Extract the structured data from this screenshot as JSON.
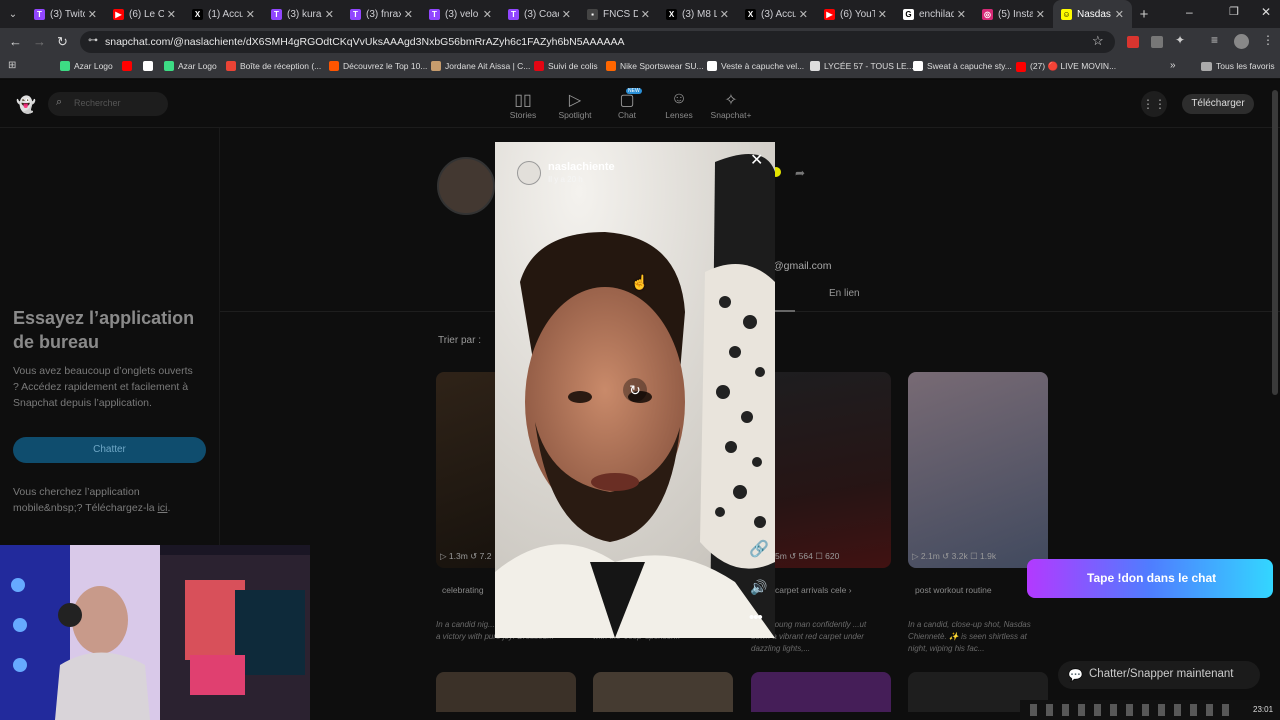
{
  "browser": {
    "tabs": [
      {
        "label": "(3) Twitc",
        "icon": "twitch-icon",
        "color": "#9146ff",
        "glyph": "T"
      },
      {
        "label": "(6) Le Ch",
        "icon": "youtube-icon",
        "color": "#ff0000",
        "glyph": "▶"
      },
      {
        "label": "(1) Accu",
        "icon": "x-icon",
        "color": "#000000",
        "glyph": "X"
      },
      {
        "label": "(3) kuran",
        "icon": "twitch-icon",
        "color": "#9146ff",
        "glyph": "T"
      },
      {
        "label": "(3) fnrax",
        "icon": "twitch-icon",
        "color": "#9146ff",
        "glyph": "T"
      },
      {
        "label": "(3) velo",
        "icon": "twitch-icon",
        "color": "#9146ff",
        "glyph": "T"
      },
      {
        "label": "(3) Coac",
        "icon": "twitch-icon",
        "color": "#9146ff",
        "glyph": "T"
      },
      {
        "label": "FNCS Dr",
        "icon": "page-icon",
        "color": "#444444",
        "glyph": "▪"
      },
      {
        "label": "(3) M8 L",
        "icon": "x-icon",
        "color": "#000000",
        "glyph": "X"
      },
      {
        "label": "(3) Accu",
        "icon": "x-icon",
        "color": "#000000",
        "glyph": "X"
      },
      {
        "label": "(6) YouTu",
        "icon": "youtube-icon",
        "color": "#ff0000",
        "glyph": "▶"
      },
      {
        "label": "enchilad",
        "icon": "google-icon",
        "color": "#ffffff",
        "glyph": "G"
      },
      {
        "label": "(5) Insta",
        "icon": "instagram-icon",
        "color": "#d62976",
        "glyph": "◎"
      },
      {
        "label": "Nasdas",
        "icon": "snapchat-icon",
        "color": "#fffc00",
        "glyph": "☺",
        "active": true
      }
    ],
    "url": "snapchat.com/@naslachiente/dX6SMH4gRGOdtCKqVvUksAAAgd3NxbG56bmRrAZyh6c1FAZyh6bN5AAAAAA",
    "bookmarks": [
      {
        "label": "Azar Logo",
        "color": "#3ddc84"
      },
      {
        "label": "",
        "color": "#ff0000"
      },
      {
        "label": "",
        "color": "#ffffff"
      },
      {
        "label": "Azar Logo",
        "color": "#3ddc84"
      },
      {
        "label": "Boîte de réception (...",
        "color": "#ea4335"
      },
      {
        "label": "Découvrez le Top 10...",
        "color": "#ff5500"
      },
      {
        "label": "Jordane Ait Aissa | C...",
        "color": "#c69c6d"
      },
      {
        "label": "Suivi de colis",
        "color": "#e30613"
      },
      {
        "label": "Nike Sportswear SU...",
        "color": "#ff6600"
      },
      {
        "label": "Veste à capuche vel...",
        "color": "#ffffff"
      },
      {
        "label": "LYCÉE 57 - TOUS LE...",
        "color": "#dddddd"
      },
      {
        "label": "Sweat à capuche sty...",
        "color": "#ffffff"
      },
      {
        "label": "(27) 🔴 LIVE MOVIN...",
        "color": "#ff0000"
      }
    ],
    "all_favs": "Tous les favoris"
  },
  "snap": {
    "search_placeholder": "Rechercher",
    "nav": [
      {
        "label": "Stories",
        "icon": "stories-icon",
        "glyph": "▯▯"
      },
      {
        "label": "Spotlight",
        "icon": "spotlight-icon",
        "glyph": "▷"
      },
      {
        "label": "Chat",
        "icon": "chat-icon",
        "glyph": "▢"
      },
      {
        "label": "Lenses",
        "icon": "lenses-icon",
        "glyph": "☺"
      },
      {
        "label": "Snapchat+",
        "icon": "snapchat-plus-icon",
        "glyph": "✧"
      }
    ],
    "chat_badge": "NEW",
    "download_label": "Télécharger",
    "sidebar": {
      "title": "Essayez l’application de bureau",
      "body": "Vous avez beaucoup d’onglets ouverts ? Accédez rapidement et facilement à Snapchat depuis l’application.",
      "chat_button": "Chatter",
      "mobile_text": "Vous cherchez l’application mobile&nbsp;? Téléchargez-la ",
      "mobile_link": "ici",
      "mobile_end": "."
    },
    "profile": {
      "email_fragment": "@gmail.com",
      "tab_links": "En lien",
      "sort_label": "Trier par :"
    },
    "cards": [
      {
        "stats": "▷ 1.3m  ↺ 7.2",
        "tag": "celebrating",
        "desc": "In a candid nig... Nasdas Chiennetè... a victory with pure joy! Dressed...",
        "color": "#3a2a1a"
      },
      {
        "stats": "",
        "tag": "",
        "desc": "... by a man in a black Adidas jersey with the 'Jeep' sponsor...",
        "color": "#2a2520"
      },
      {
        "stats": "5m  ↺ 564  ☐ 620",
        "tag": "carpet arrivals   cele  ›",
        "desc": "...s a young man confidently ...ut down a vibrant red carpet under dazzling lights,...",
        "color": "#3b2020"
      },
      {
        "stats": "▷ 2.1m  ↺ 3.2k  ☐ 1.9k",
        "tag": "post workout routine",
        "desc": "In a candid, close-up shot, Nasdas Chiennetè. ✨ is seen shirtless at night, wiping his fac...",
        "color": "#5a4a5a"
      }
    ],
    "chat_now": "Chatter/Snapper maintenant",
    "story": {
      "username": "naslachiente",
      "time": "Il y a 20 h"
    }
  },
  "overlay": {
    "donation_banner": "Tape !don dans le chat"
  },
  "system": {
    "clock": "23:01"
  }
}
